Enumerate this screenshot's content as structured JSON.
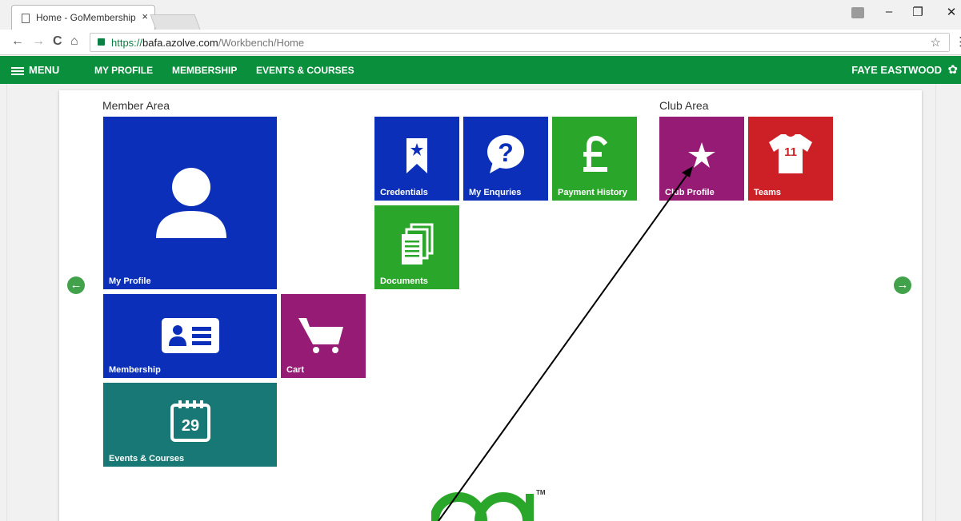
{
  "browser": {
    "tab_title": "Home - GoMembership",
    "tab_close": "×",
    "url_scheme": "https://",
    "url_host": "bafa.azolve.com",
    "url_path": "/Workbench/Home",
    "window_minimize": "–",
    "window_restore": "❐",
    "window_close": "✕",
    "back": "←",
    "forward": "→",
    "reload": "C",
    "home": "⌂",
    "bookmark": "☆",
    "more": "⋮"
  },
  "appbar": {
    "menu_label": "MENU",
    "nav": [
      "MY PROFILE",
      "MEMBERSHIP",
      "EVENTS & COURSES"
    ],
    "user_name": "FAYE EASTWOOD",
    "gear": "✿"
  },
  "member_area": {
    "title": "Member Area",
    "tiles": [
      {
        "label": "My Profile",
        "icon": "user-icon",
        "color": "#0b2fb8"
      },
      {
        "label": "Membership",
        "icon": "id-card-icon",
        "color": "#0b2fb8"
      },
      {
        "label": "Cart",
        "icon": "cart-icon",
        "color": "#951b74"
      },
      {
        "label": "Events & Courses",
        "icon": "calendar-icon",
        "color": "#177875",
        "calendar_day": "29"
      },
      {
        "label": "Credentials",
        "icon": "bookmark-star-icon",
        "color": "#0b2fb8"
      },
      {
        "label": "My Enquries",
        "icon": "question-bubble-icon",
        "color": "#0b2fb8"
      },
      {
        "label": "Payment History",
        "icon": "pound-icon",
        "color": "#2aa72a"
      },
      {
        "label": "Documents",
        "icon": "documents-icon",
        "color": "#2aa72a"
      }
    ]
  },
  "club_area": {
    "title": "Club Area",
    "tiles": [
      {
        "label": "Club Profile",
        "icon": "star-icon",
        "color": "#951b74"
      },
      {
        "label": "Teams",
        "icon": "shirt-icon",
        "color": "#cc1f26",
        "shirt_number": "11"
      }
    ]
  },
  "arrows": {
    "prev": "←",
    "next": "→"
  },
  "logo": {
    "tm": "TM"
  }
}
